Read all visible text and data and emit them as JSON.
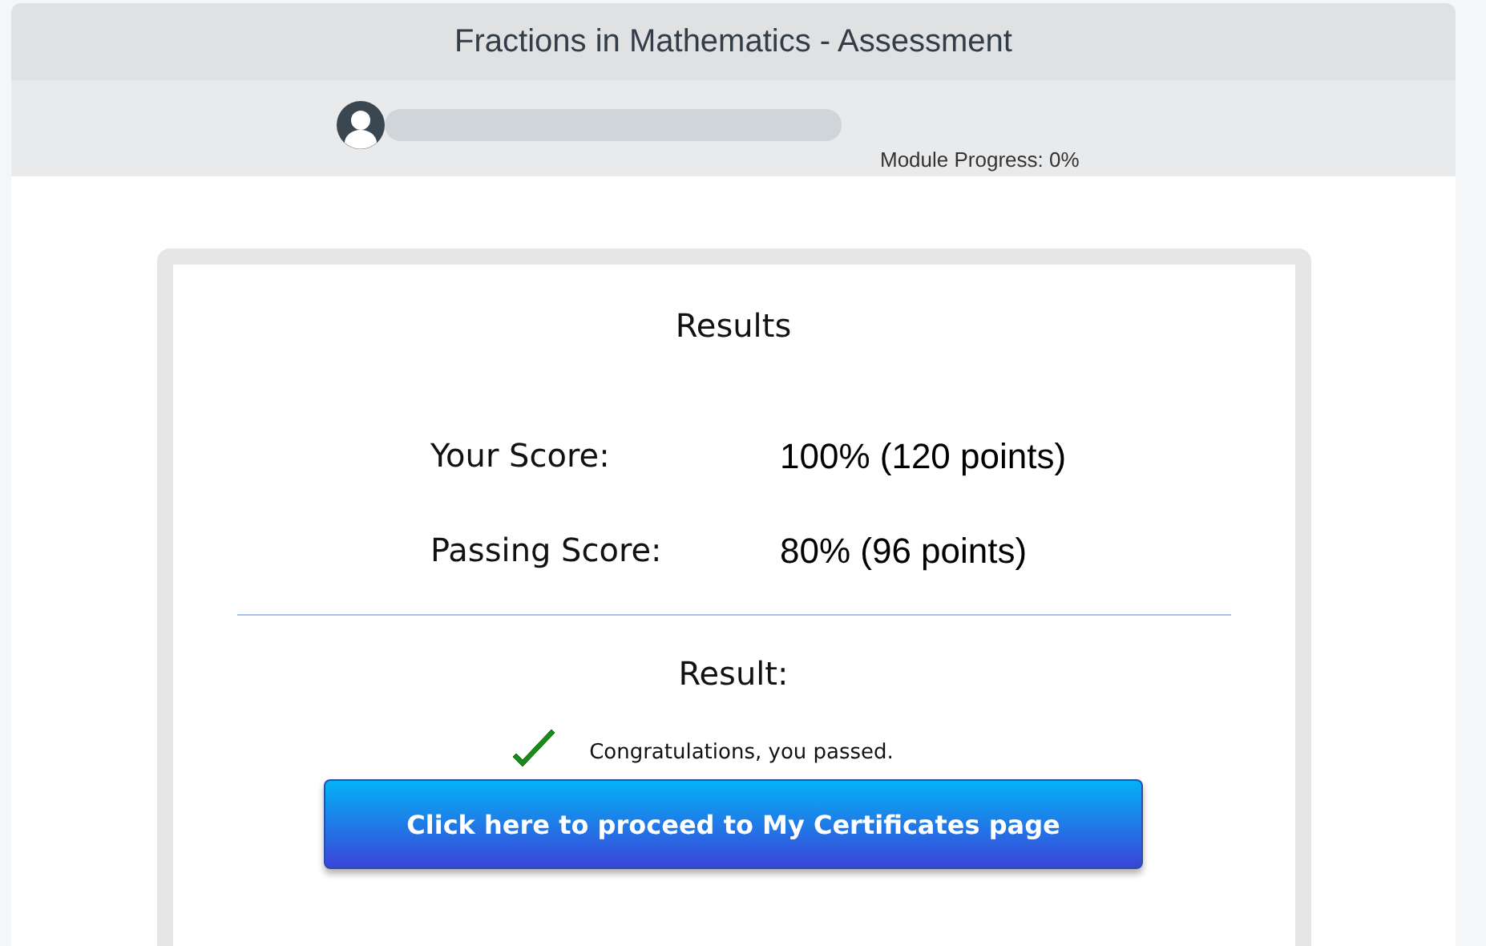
{
  "header": {
    "title": "Fractions in Mathematics - Assessment"
  },
  "progress": {
    "label": "Module Progress: 0%"
  },
  "results": {
    "title": "Results",
    "scores": [
      {
        "label": "Your Score:",
        "value": "100% (120 points)"
      },
      {
        "label": "Passing Score:",
        "value": "80% (96 points)"
      }
    ],
    "result_heading": "Result:",
    "passed": true,
    "message": "Congratulations, you passed.",
    "button": "Click here to proceed to My Certificates page"
  }
}
